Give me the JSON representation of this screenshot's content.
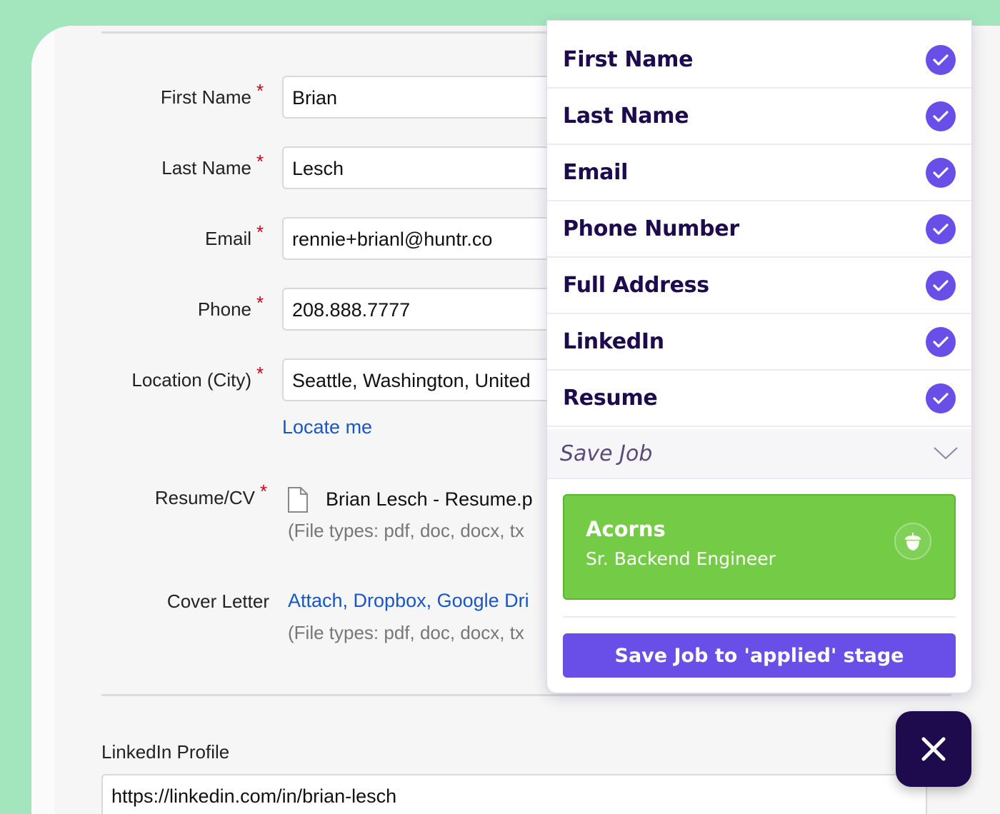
{
  "form": {
    "first_name": {
      "label": "First Name",
      "required": "*",
      "value": "Brian"
    },
    "last_name": {
      "label": "Last Name",
      "required": "*",
      "value": "Lesch"
    },
    "email": {
      "label": "Email",
      "required": "*",
      "value": "rennie+brianl@huntr.co"
    },
    "phone": {
      "label": "Phone",
      "required": "*",
      "value": "208.888.7777"
    },
    "location": {
      "label": "Location (City)",
      "required": "*",
      "value": "Seattle, Washington, United",
      "locate_link": "Locate me"
    },
    "resume": {
      "label": "Resume/CV",
      "required": "*",
      "file_name": "Brian Lesch - Resume.p",
      "file_types": "(File types: pdf, doc, docx, tx"
    },
    "cover_letter": {
      "label": "Cover Letter",
      "attach_links": "Attach, Dropbox, Google Dri",
      "file_types": "(File types: pdf, doc, docx, tx"
    },
    "linkedin": {
      "label": "LinkedIn Profile",
      "value": "https://linkedin.com/in/brian-lesch"
    }
  },
  "panel": {
    "fields": [
      {
        "label": "First Name"
      },
      {
        "label": "Last Name"
      },
      {
        "label": "Email"
      },
      {
        "label": "Phone Number"
      },
      {
        "label": "Full Address"
      },
      {
        "label": "LinkedIn"
      },
      {
        "label": "Resume"
      }
    ],
    "save_job": {
      "title": "Save Job",
      "company": "Acorns",
      "job_title": "Sr. Backend Engineer",
      "button_label": "Save Job to 'applied' stage"
    }
  },
  "icons": {
    "check": "check-icon",
    "chevron": "chevron-down-icon",
    "acorn": "acorn-icon",
    "close": "close-icon",
    "file": "file-icon"
  },
  "colors": {
    "background": "#a3e6bd",
    "accent": "#6a4ee8",
    "dark": "#1d0b4e",
    "job_card": "#74cc46",
    "required": "#d0021b",
    "link": "#1a56c4"
  }
}
